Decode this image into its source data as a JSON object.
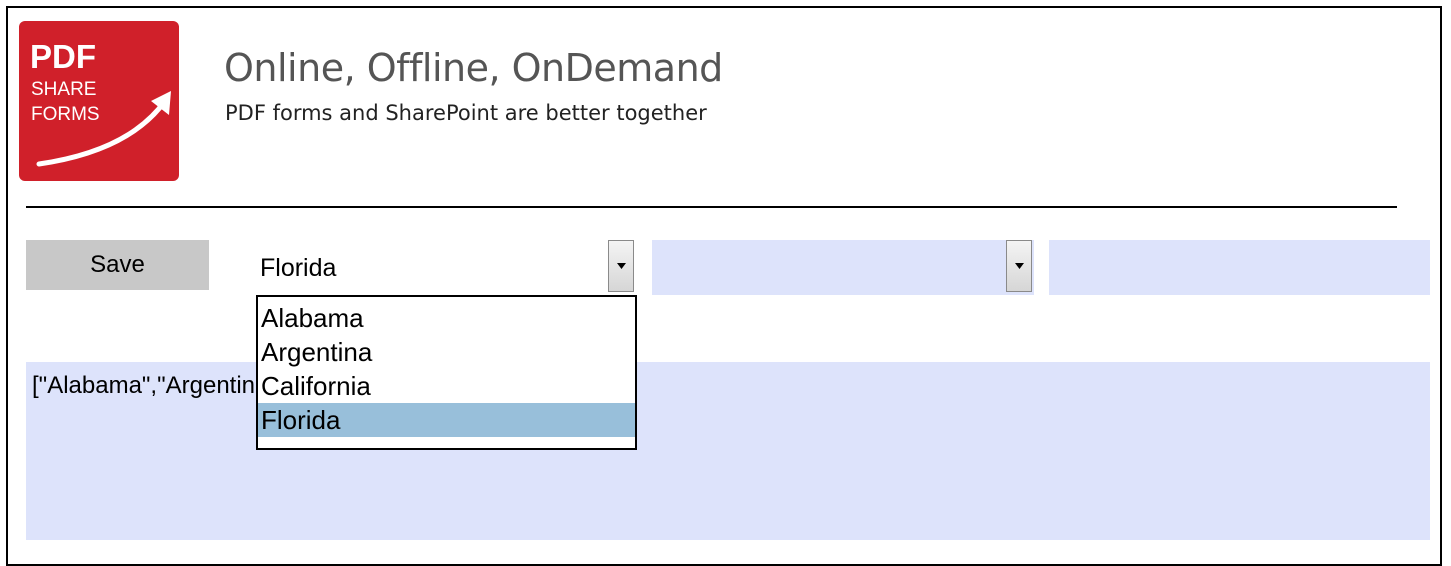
{
  "logo": {
    "line1": "PDF",
    "line2": "SHARE",
    "line3": "FORMS",
    "color": "#d0202a"
  },
  "header": {
    "title": "Online, Offline, OnDemand",
    "subtitle": "PDF forms and SharePoint are better together"
  },
  "toolbar": {
    "save_label": "Save"
  },
  "form": {
    "select1": {
      "value": "Florida",
      "options": [
        "Alabama",
        "Argentina",
        "California",
        "Florida"
      ],
      "selected_index": 3
    },
    "select2": {
      "value": ""
    },
    "text_field": {
      "value": ""
    },
    "textarea": {
      "value": "[\"Alabama\",\"Argentina\",\"California\",\"Florida\"]"
    }
  },
  "colors": {
    "field_fill": "#dde3fb",
    "button_fill": "#c8c8c8",
    "selected_option": "#98bfda",
    "brand_red": "#d0202a"
  },
  "icons": {
    "dropdown_arrow": "chevron-down-icon",
    "logo_arrow": "arrow-up-right-icon"
  }
}
